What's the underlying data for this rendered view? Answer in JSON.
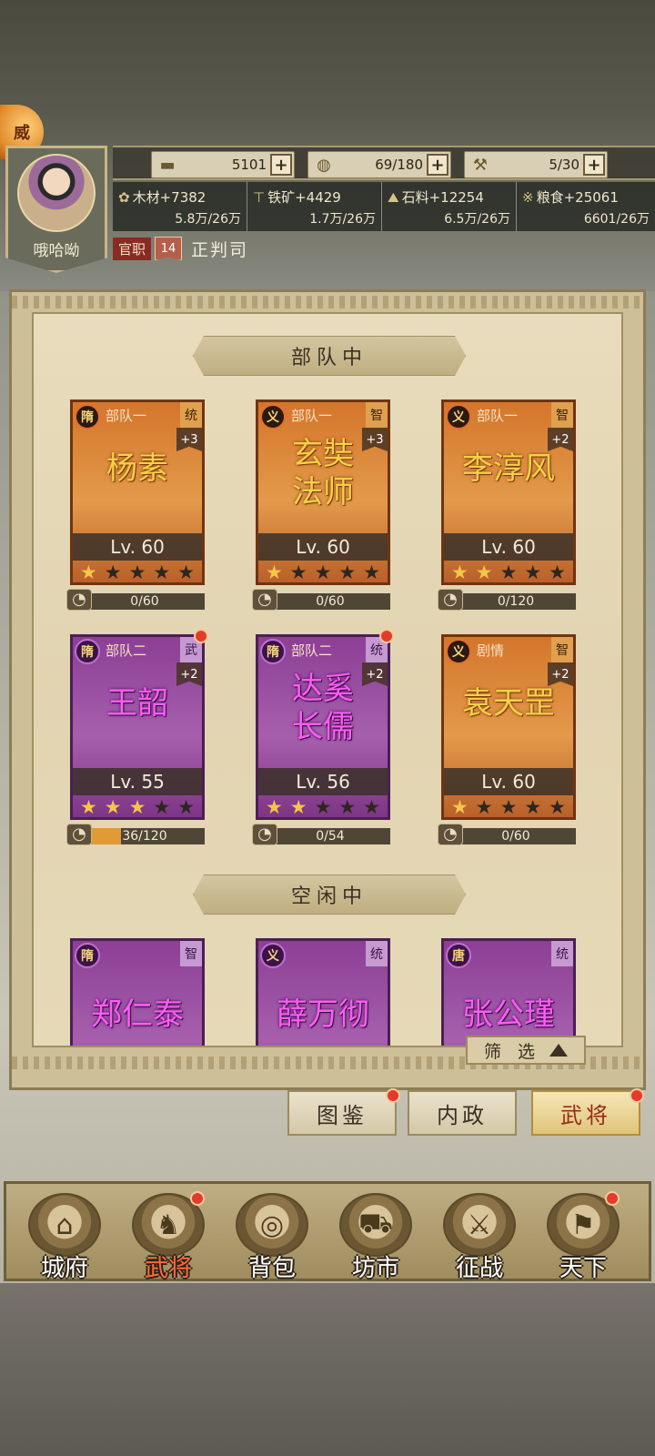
{
  "header": {
    "player_name": "哦哈呦",
    "prestige_icon": "prestige-badge-icon",
    "prestige_glyph": "威",
    "resources": {
      "gold": {
        "icon": "gold-ingot-icon",
        "value": "5101"
      },
      "troops": {
        "icon": "drum-icon",
        "value": "69/180"
      },
      "tools": {
        "icon": "hammer-icon",
        "value": "5/30"
      }
    },
    "production": [
      {
        "label": "木材+7382",
        "capacity": "5.8万/26万",
        "icon": "wood-icon"
      },
      {
        "label": "铁矿+4429",
        "capacity": "1.7万/26万",
        "icon": "anvil-icon"
      },
      {
        "label": "石料+12254",
        "capacity": "6.5万/26万",
        "icon": "stone-icon"
      },
      {
        "label": "粮食+25061",
        "capacity": "6601/26万",
        "icon": "grain-icon"
      }
    ],
    "office": {
      "label": "官职",
      "level": "14",
      "title": "正判司"
    }
  },
  "sections": {
    "in_team": "部队中",
    "idle": "空闲中"
  },
  "generals_in_team": [
    {
      "name": "杨素",
      "team": "部队一",
      "faction": "隋",
      "attr": "统",
      "bonus": "+3",
      "level": "Lv. 60",
      "stars": 1,
      "progress_text": "0/60",
      "progress": 0,
      "color": "orange",
      "dot": false
    },
    {
      "name": "玄奘法师",
      "name_line1": "玄奘",
      "name_line2": "法师",
      "team": "部队一",
      "faction": "义",
      "attr": "智",
      "bonus": "+3",
      "level": "Lv. 60",
      "stars": 1,
      "progress_text": "0/60",
      "progress": 0,
      "color": "orange",
      "dot": false
    },
    {
      "name": "李淳风",
      "team": "部队一",
      "faction": "义",
      "attr": "智",
      "bonus": "+2",
      "level": "Lv. 60",
      "stars": 2,
      "progress_text": "0/120",
      "progress": 0,
      "color": "orange",
      "dot": false
    },
    {
      "name": "王韶",
      "team": "部队二",
      "faction": "隋",
      "attr": "武",
      "bonus": "+2",
      "level": "Lv. 55",
      "stars": 3,
      "progress_text": "36/120",
      "progress": 0.3,
      "color": "purple",
      "dot": true
    },
    {
      "name": "达奚长儒",
      "name_line1": "达奚",
      "name_line2": "长儒",
      "team": "部队二",
      "faction": "隋",
      "attr": "统",
      "bonus": "+2",
      "level": "Lv. 56",
      "stars": 2,
      "progress_text": "0/54",
      "progress": 0,
      "color": "purple",
      "dot": true
    },
    {
      "name": "袁天罡",
      "team": "剧情",
      "faction": "义",
      "attr": "智",
      "bonus": "+2",
      "level": "Lv. 60",
      "stars": 1,
      "progress_text": "0/60",
      "progress": 0,
      "color": "orange",
      "dot": false
    }
  ],
  "generals_idle": [
    {
      "name": "郑仁泰",
      "faction": "隋",
      "attr": "智",
      "color": "purple"
    },
    {
      "name": "薛万彻",
      "faction": "义",
      "attr": "统",
      "color": "purple"
    },
    {
      "name": "张公瑾",
      "faction": "唐",
      "attr": "统",
      "color": "purple"
    }
  ],
  "filter": {
    "label": "筛 选"
  },
  "subtabs": [
    {
      "label": "图鉴",
      "active": false,
      "dot": true
    },
    {
      "label": "内政",
      "active": false,
      "dot": false
    },
    {
      "label": "武将",
      "active": true,
      "dot": true
    }
  ],
  "nav": [
    {
      "label": "城府",
      "icon": "city-gate-icon",
      "active": false,
      "dot": false
    },
    {
      "label": "武将",
      "icon": "general-icon",
      "active": true,
      "dot": true
    },
    {
      "label": "背包",
      "icon": "bag-icon",
      "active": false,
      "dot": false
    },
    {
      "label": "坊市",
      "icon": "market-cart-icon",
      "active": false,
      "dot": false
    },
    {
      "label": "征战",
      "icon": "battle-icon",
      "active": false,
      "dot": false
    },
    {
      "label": "天下",
      "icon": "world-icon",
      "active": false,
      "dot": true
    }
  ],
  "colors": {
    "orange_card": "#d4762c",
    "purple_card": "#a65fad",
    "name_gold": "#f7d046",
    "name_pink": "#ff5cf5",
    "star": "#f4c64a",
    "notify": "#e33b2a"
  }
}
